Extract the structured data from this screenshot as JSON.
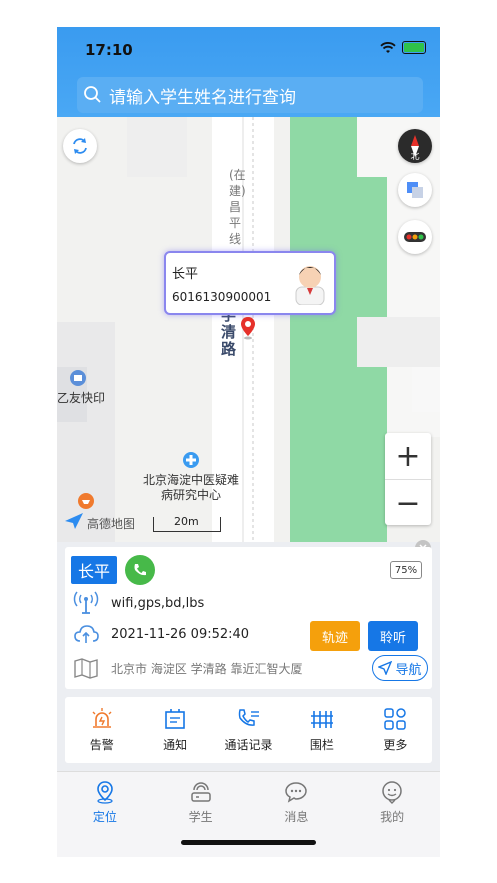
{
  "status": {
    "time": "17:10"
  },
  "search": {
    "placeholder": "请输入学生姓名进行查询"
  },
  "map": {
    "road_label": "学清路",
    "construction_label": "(在建)昌平线",
    "poi_print": "乙友快印",
    "poi_hospital": "北京海淀中医疑难病研究中心",
    "logo": "高德地图",
    "scale": "20m",
    "zoom_in": "+",
    "zoom_out": "−",
    "compass": "北"
  },
  "bubble": {
    "name": "长平",
    "number": "6016130900001"
  },
  "student": {
    "name": "长平",
    "battery": "75%",
    "location_types": "wifi,gps,bd,lbs",
    "timestamp": "2021-11-26 09:52:40",
    "address": "北京市 海淀区 学清路 靠近汇智大厦",
    "track_label": "轨迹",
    "listen_label": "聆听",
    "navigate_label": "导航"
  },
  "actions": [
    {
      "label": "告警",
      "icon": "alarm-light-icon"
    },
    {
      "label": "通知",
      "icon": "notice-icon"
    },
    {
      "label": "通话记录",
      "icon": "call-log-icon"
    },
    {
      "label": "围栏",
      "icon": "fence-icon"
    },
    {
      "label": "更多",
      "icon": "grid-icon"
    }
  ],
  "tabs": [
    {
      "label": "定位",
      "icon": "location-icon",
      "active": true
    },
    {
      "label": "学生",
      "icon": "student-icon"
    },
    {
      "label": "消息",
      "icon": "message-icon"
    },
    {
      "label": "我的",
      "icon": "profile-icon"
    }
  ],
  "colors": {
    "primary": "#1677e6",
    "orange": "#f5a00c",
    "green": "#47b949",
    "park": "#8fd9a5"
  }
}
